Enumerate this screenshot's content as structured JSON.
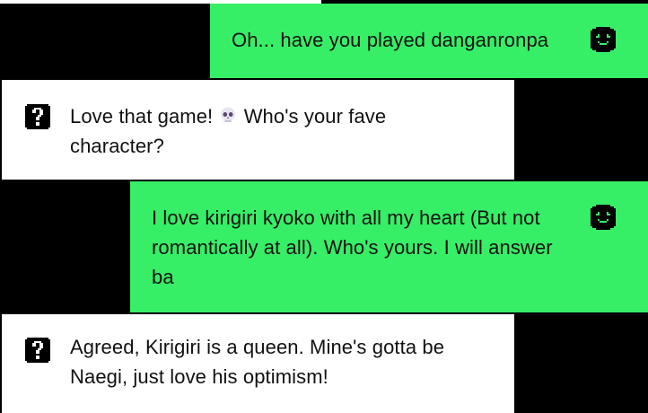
{
  "conversation": {
    "messages": [
      {
        "sender": "you",
        "text": "Oh... have you played danganronpa",
        "avatar_icon": "ghost-face-icon"
      },
      {
        "sender": "anon",
        "text_before_emoji": "Love that game! ",
        "emoji": "skull-emoji",
        "text_after_emoji": " Who's your fave character?",
        "avatar_icon": "question-mark-icon"
      },
      {
        "sender": "you",
        "text": "I love kirigiri kyoko with all my heart (But not romantically at all). Who's yours. I will answer ba",
        "avatar_icon": "ghost-face-icon"
      },
      {
        "sender": "anon",
        "text": "Agreed, Kirigiri is a queen. Mine's gotta be Naegi, just love his optimism!",
        "avatar_icon": "question-mark-icon"
      }
    ]
  },
  "colors": {
    "background": "#000000",
    "sent_bubble": "#37ee67",
    "received_bubble": "#ffffff",
    "text": "#111111"
  }
}
